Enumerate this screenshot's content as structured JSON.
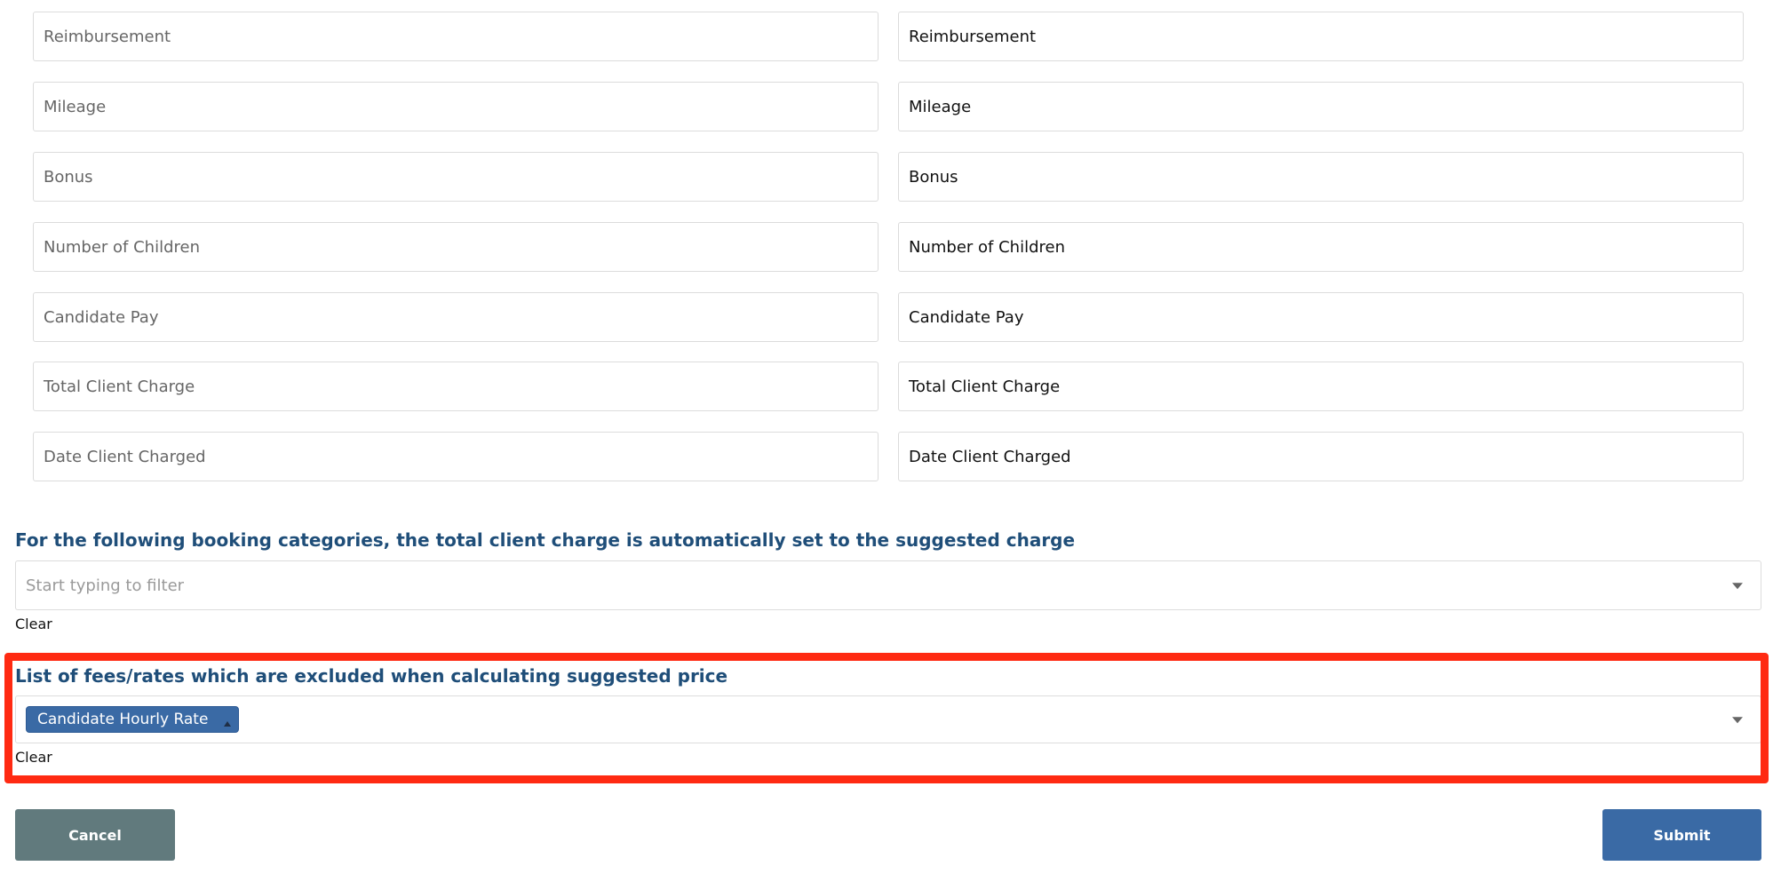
{
  "fields": {
    "placeholders": [
      "Reimbursement",
      "Mileage",
      "Bonus",
      "Number of Children",
      "Candidate Pay",
      "Total Client Charge",
      "Date Client Charged"
    ],
    "values": [
      "Reimbursement",
      "Mileage",
      "Bonus",
      "Number of Children",
      "Candidate Pay",
      "Total Client Charge",
      "Date Client Charged"
    ]
  },
  "booking_categories": {
    "title": "For the following booking categories, the total client charge is automatically set to the suggested charge",
    "placeholder": "Start typing to filter",
    "clear_label": "Clear"
  },
  "excluded_fees": {
    "title": "List of fees/rates which are excluded when calculating suggested price",
    "selected": [
      "Candidate Hourly Rate"
    ],
    "clear_label": "Clear"
  },
  "actions": {
    "cancel_label": "Cancel",
    "submit_label": "Submit"
  },
  "colors": {
    "heading": "#1f4e79",
    "tag": "#3a6aa5",
    "cancel": "#617a7d",
    "submit": "#3a6aa5",
    "highlight": "#ff2a12"
  }
}
